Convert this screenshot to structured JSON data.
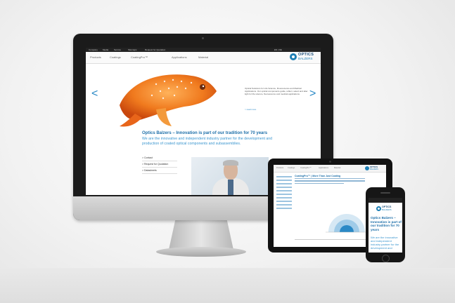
{
  "site": {
    "topbar": [
      "Company",
      "Media",
      "Service",
      "Sitemaps",
      "Request for Quotation",
      "EN | DE"
    ],
    "nav": [
      "Products",
      "Coatings",
      "CoatingPro™",
      "Applications",
      "Material"
    ],
    "logo": {
      "line1": "OPTICS",
      "line2": "BALZERS"
    },
    "hero": {
      "text": "Optical Solutions for Life Science, Fluorescence and Medical Applications. Our optical components guide, reflect, select and alter light for life science, fluorescence and medical applications.",
      "link": "> read more"
    },
    "arrows": {
      "left": "<",
      "right": ">"
    },
    "headline": "Optics Balzers – Innovation is part of our tradition for 70 years",
    "subline": "We are the innovative and independent industry partner for the development and production of coated optical components and subassemblies.",
    "links": [
      "> Contact",
      "> Request for Quotation",
      "> Datasheets"
    ]
  },
  "tablet": {
    "nav": [
      "Products",
      "Coatings",
      "CoatingPro™",
      "Applications",
      "Material"
    ],
    "title": "CoatingPro™ | More Than Just Coating"
  },
  "phone": {
    "logo": {
      "line1": "OPTICS",
      "line2": "BALZERS"
    },
    "headline": "Optics Balzers – Innovation is part of our tradition for 70 years",
    "subline": "We are the innovative and independent industry partner for the development and"
  },
  "colors": {
    "brand": "#1d6fa9",
    "accent": "#3b96cf",
    "fish": "#f07a1e"
  }
}
